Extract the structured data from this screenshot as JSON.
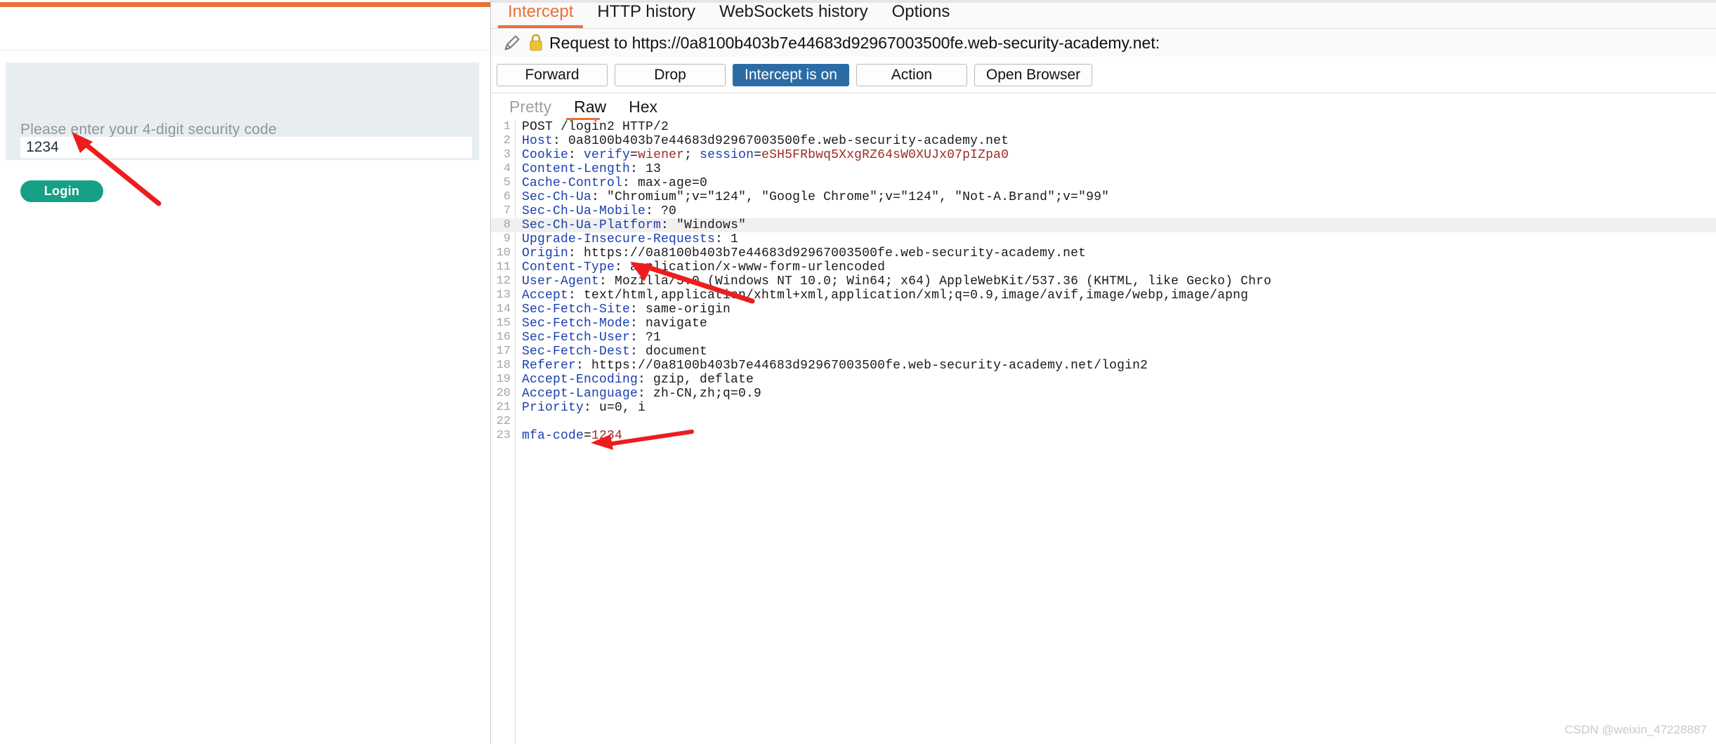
{
  "left_page": {
    "accent_color": "#e8703a",
    "panel_bg": "#e8eef0",
    "mfa_label": "Please enter your 4-digit security code",
    "mfa_value": "1234",
    "mfa_placeholder": "",
    "login_label": "Login",
    "login_color": "#16a085"
  },
  "burp": {
    "accent_color": "#e8703a",
    "active_button_color": "#2c6ca5",
    "tabs": [
      {
        "label": "Intercept",
        "active": true
      },
      {
        "label": "HTTP history",
        "active": false
      },
      {
        "label": "WebSockets history",
        "active": false
      },
      {
        "label": "Options",
        "active": false
      }
    ],
    "request_title": "Request to https://0a8100b403b7e44683d92967003500fe.web-security-academy.net:",
    "toolbar": {
      "forward": "Forward",
      "drop": "Drop",
      "intercept": "Intercept is on",
      "action": "Action",
      "open_browser": "Open Browser"
    },
    "view_tabs": [
      {
        "label": "Pretty",
        "state": "dim"
      },
      {
        "label": "Raw",
        "state": "active"
      },
      {
        "label": "Hex",
        "state": "normal"
      }
    ],
    "request_lines": [
      {
        "n": "1",
        "highlight": false,
        "parts": [
          {
            "t": "POST /login2 HTTP/2",
            "c": "hv"
          }
        ]
      },
      {
        "n": "2",
        "highlight": false,
        "parts": [
          {
            "t": "Host",
            "c": "hk"
          },
          {
            "t": ": 0a8100b403b7e44683d92967003500fe.web-security-academy.net",
            "c": "hv"
          }
        ]
      },
      {
        "n": "3",
        "highlight": false,
        "parts": [
          {
            "t": "Cookie",
            "c": "hk"
          },
          {
            "t": ": ",
            "c": "hv"
          },
          {
            "t": "verify",
            "c": "pn"
          },
          {
            "t": "=",
            "c": "hv"
          },
          {
            "t": "wiener",
            "c": "cv"
          },
          {
            "t": "; ",
            "c": "hv"
          },
          {
            "t": "session",
            "c": "pn"
          },
          {
            "t": "=",
            "c": "hv"
          },
          {
            "t": "eSH5FRbwq5XxgRZ64sW0XUJx07pIZpa0",
            "c": "cv"
          }
        ]
      },
      {
        "n": "4",
        "highlight": false,
        "parts": [
          {
            "t": "Content-Length",
            "c": "hk"
          },
          {
            "t": ": 13",
            "c": "hv"
          }
        ]
      },
      {
        "n": "5",
        "highlight": false,
        "parts": [
          {
            "t": "Cache-Control",
            "c": "hk"
          },
          {
            "t": ": max-age=0",
            "c": "hv"
          }
        ]
      },
      {
        "n": "6",
        "highlight": false,
        "parts": [
          {
            "t": "Sec-Ch-Ua",
            "c": "hk"
          },
          {
            "t": ": \"Chromium\";v=\"124\", \"Google Chrome\";v=\"124\", \"Not-A.Brand\";v=\"99\"",
            "c": "hv"
          }
        ]
      },
      {
        "n": "7",
        "highlight": false,
        "parts": [
          {
            "t": "Sec-Ch-Ua-Mobile",
            "c": "hk"
          },
          {
            "t": ": ?0",
            "c": "hv"
          }
        ]
      },
      {
        "n": "8",
        "highlight": true,
        "parts": [
          {
            "t": "Sec-Ch-Ua-Platform",
            "c": "hk"
          },
          {
            "t": ": \"Windows\"",
            "c": "hv"
          }
        ]
      },
      {
        "n": "9",
        "highlight": false,
        "parts": [
          {
            "t": "Upgrade-Insecure-Requests",
            "c": "hk"
          },
          {
            "t": ": 1",
            "c": "hv"
          }
        ]
      },
      {
        "n": "10",
        "highlight": false,
        "parts": [
          {
            "t": "Origin",
            "c": "hk"
          },
          {
            "t": ": https://0a8100b403b7e44683d92967003500fe.web-security-academy.net",
            "c": "hv"
          }
        ]
      },
      {
        "n": "11",
        "highlight": false,
        "parts": [
          {
            "t": "Content-Type",
            "c": "hk"
          },
          {
            "t": ": application/x-www-form-urlencoded",
            "c": "hv"
          }
        ]
      },
      {
        "n": "12",
        "highlight": false,
        "parts": [
          {
            "t": "User-Agent",
            "c": "hk"
          },
          {
            "t": ": Mozilla/5.0 (Windows NT 10.0; Win64; x64) AppleWebKit/537.36 (KHTML, like Gecko) Chro",
            "c": "hv"
          }
        ]
      },
      {
        "n": "13",
        "highlight": false,
        "parts": [
          {
            "t": "Accept",
            "c": "hk"
          },
          {
            "t": ": text/html,application/xhtml+xml,application/xml;q=0.9,image/avif,image/webp,image/apng",
            "c": "hv"
          }
        ]
      },
      {
        "n": "14",
        "highlight": false,
        "parts": [
          {
            "t": "Sec-Fetch-Site",
            "c": "hk"
          },
          {
            "t": ": same-origin",
            "c": "hv"
          }
        ]
      },
      {
        "n": "15",
        "highlight": false,
        "parts": [
          {
            "t": "Sec-Fetch-Mode",
            "c": "hk"
          },
          {
            "t": ": navigate",
            "c": "hv"
          }
        ]
      },
      {
        "n": "16",
        "highlight": false,
        "parts": [
          {
            "t": "Sec-Fetch-User",
            "c": "hk"
          },
          {
            "t": ": ?1",
            "c": "hv"
          }
        ]
      },
      {
        "n": "17",
        "highlight": false,
        "parts": [
          {
            "t": "Sec-Fetch-Dest",
            "c": "hk"
          },
          {
            "t": ": document",
            "c": "hv"
          }
        ]
      },
      {
        "n": "18",
        "highlight": false,
        "parts": [
          {
            "t": "Referer",
            "c": "hk"
          },
          {
            "t": ": https://0a8100b403b7e44683d92967003500fe.web-security-academy.net/login2",
            "c": "hv"
          }
        ]
      },
      {
        "n": "19",
        "highlight": false,
        "parts": [
          {
            "t": "Accept-Encoding",
            "c": "hk"
          },
          {
            "t": ": gzip, deflate",
            "c": "hv"
          }
        ]
      },
      {
        "n": "20",
        "highlight": false,
        "parts": [
          {
            "t": "Accept-Language",
            "c": "hk"
          },
          {
            "t": ": zh-CN,zh;q=0.9",
            "c": "hv"
          }
        ]
      },
      {
        "n": "21",
        "highlight": false,
        "parts": [
          {
            "t": "Priority",
            "c": "hk"
          },
          {
            "t": ": u=0, i",
            "c": "hv"
          }
        ]
      },
      {
        "n": "22",
        "highlight": false,
        "parts": [
          {
            "t": "",
            "c": "hv"
          }
        ]
      },
      {
        "n": "23",
        "highlight": false,
        "parts": [
          {
            "t": "mfa-code",
            "c": "pn"
          },
          {
            "t": "=",
            "c": "hv"
          },
          {
            "t": "1234",
            "c": "cv"
          }
        ]
      }
    ]
  },
  "watermark": "CSDN @weixin_47228887"
}
